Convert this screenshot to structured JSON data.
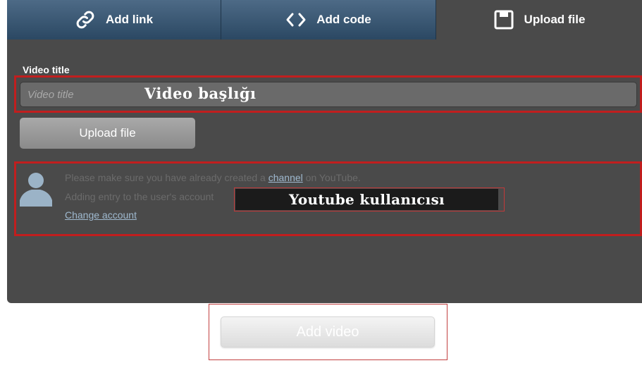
{
  "tabs": [
    {
      "label": "Add link",
      "icon": "link-icon"
    },
    {
      "label": "Add code",
      "icon": "code-icon"
    },
    {
      "label": "Upload file",
      "icon": "floppy-disk-icon"
    }
  ],
  "active_tab": "Upload file",
  "form": {
    "title_label": "Video title",
    "title_placeholder": "Video title",
    "upload_button_label": "Upload file"
  },
  "youtube": {
    "line1_prefix": "Please make sure you have already created a",
    "channel_link": "channel",
    "line1_suffix": "on YouTube.",
    "line2": "Adding entry to the user's account",
    "change_account": "Change account"
  },
  "annotations": {
    "video_title": "Video başlığı",
    "youtube_user": "Youtube kullanıcısı"
  },
  "add_video_label": "Add video",
  "colors": {
    "panel_bg": "#4a4a4a",
    "tab_bg": "#3a5774",
    "annotation_red": "#c11e1e",
    "link": "#9fb9cf"
  }
}
